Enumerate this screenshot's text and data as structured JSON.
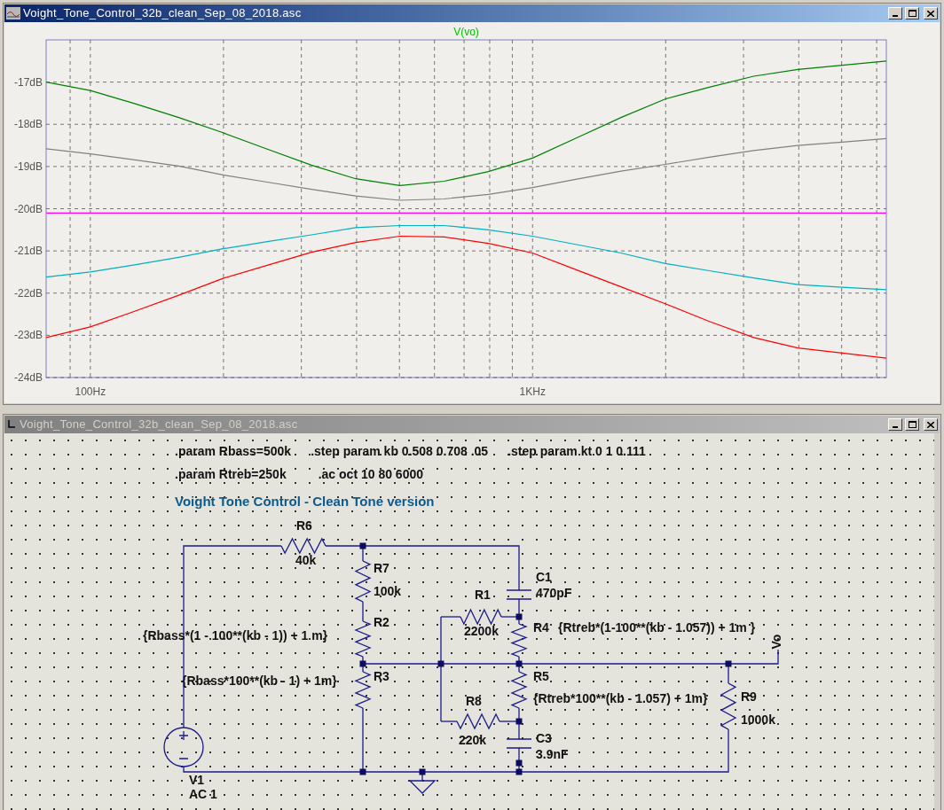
{
  "plot_window": {
    "title": "Voight_Tone_Control_32b_clean_Sep_08_2018.asc",
    "active": true,
    "chart_data": {
      "type": "line",
      "title": "V(vo)",
      "categories": [
        null,
        "100Hz",
        null,
        null,
        null,
        null,
        null,
        null,
        null,
        null,
        null,
        "1KHz",
        null,
        null,
        null,
        null,
        null,
        null,
        null,
        null
      ],
      "ylim": [
        -24,
        -16
      ],
      "grid": true,
      "yticks": [
        {
          "value": -17,
          "label": "-17dB"
        },
        {
          "value": -18,
          "label": "-18dB"
        },
        {
          "value": -19,
          "label": "-19dB"
        },
        {
          "value": -20,
          "label": "-20dB"
        },
        {
          "value": -21,
          "label": "-21dB"
        },
        {
          "value": -22,
          "label": "-22dB"
        },
        {
          "value": -23,
          "label": "-23dB"
        },
        {
          "value": -24,
          "label": "-24dB"
        }
      ],
      "series": [
        {
          "color": "#008000",
          "values": [
            -17.0,
            -17.2,
            -17.51,
            -17.84,
            -18.2,
            -18.59,
            -18.97,
            -19.29,
            -19.45,
            -19.35,
            -19.12,
            -18.8,
            -18.32,
            -17.84,
            -17.4,
            -17.12,
            -16.86,
            -16.7,
            -16.6,
            -16.5
          ]
        },
        {
          "color": "#808080",
          "values": [
            -18.58,
            -18.7,
            -18.84,
            -18.99,
            -19.2,
            -19.37,
            -19.54,
            -19.7,
            -19.8,
            -19.77,
            -19.66,
            -19.5,
            -19.3,
            -19.11,
            -18.95,
            -18.78,
            -18.62,
            -18.5,
            -18.42,
            -18.34
          ]
        },
        {
          "color": "#ff00ff",
          "values": [
            -20.1,
            -20.1,
            -20.1,
            -20.1,
            -20.1,
            -20.1,
            -20.1,
            -20.1,
            -20.1,
            -20.1,
            -20.1,
            -20.1,
            -20.1,
            -20.1,
            -20.1,
            -20.1,
            -20.1,
            -20.1,
            -20.1,
            -20.1
          ]
        },
        {
          "color": "#00b0c0",
          "values": [
            -21.62,
            -21.5,
            -21.33,
            -21.15,
            -20.95,
            -20.78,
            -20.62,
            -20.45,
            -20.4,
            -20.4,
            -20.5,
            -20.65,
            -20.85,
            -21.05,
            -21.3,
            -21.47,
            -21.64,
            -21.8,
            -21.86,
            -21.92
          ]
        },
        {
          "color": "#ff0000",
          "values": [
            -23.05,
            -22.8,
            -22.43,
            -22.05,
            -21.65,
            -21.34,
            -21.03,
            -20.8,
            -20.65,
            -20.67,
            -20.82,
            -21.05,
            -21.45,
            -21.85,
            -22.25,
            -22.67,
            -23.05,
            -23.3,
            -23.42,
            -23.54
          ]
        }
      ]
    }
  },
  "schematic_window": {
    "title": "Voight_Tone_Control_32b_clean_Sep_08_2018.asc",
    "active": false,
    "directives": [
      ".param Rbass=500k",
      ".step param kb 0.508 0.708 .05",
      ".step param kt 0 1 0.111",
      ".param Rtreb=250k",
      ".ac oct 10 80 6000"
    ],
    "heading": "Voight Tone Control - Clean Tone version",
    "components": [
      {
        "kind": "voltage_source",
        "name": "V1",
        "value": "AC 1"
      },
      {
        "kind": "resistor",
        "name": "R6",
        "value": "40k"
      },
      {
        "kind": "resistor",
        "name": "R7",
        "value": "100k"
      },
      {
        "kind": "resistor",
        "name": "R2",
        "value": "{Rbass*(1 - 100**(kb - 1)) + 1 m}"
      },
      {
        "kind": "resistor",
        "name": "R3",
        "value": "{Rbass*100**(kb - 1) + 1m}"
      },
      {
        "kind": "capacitor",
        "name": "C1",
        "value": "470pF"
      },
      {
        "kind": "resistor",
        "name": "R1",
        "value": "2200k"
      },
      {
        "kind": "resistor",
        "name": "R4",
        "value": "{Rtreb*(1-100**(kb - 1.057)) + 1m }"
      },
      {
        "kind": "resistor",
        "name": "R5",
        "value": "{Rtreb*100**(kb - 1.057) + 1m}"
      },
      {
        "kind": "resistor",
        "name": "R8",
        "value": "220k"
      },
      {
        "kind": "capacitor",
        "name": "C3",
        "value": "3.9nF"
      },
      {
        "kind": "resistor",
        "name": "R9",
        "value": "1000k"
      }
    ],
    "net_labels": [
      "Vo"
    ]
  }
}
